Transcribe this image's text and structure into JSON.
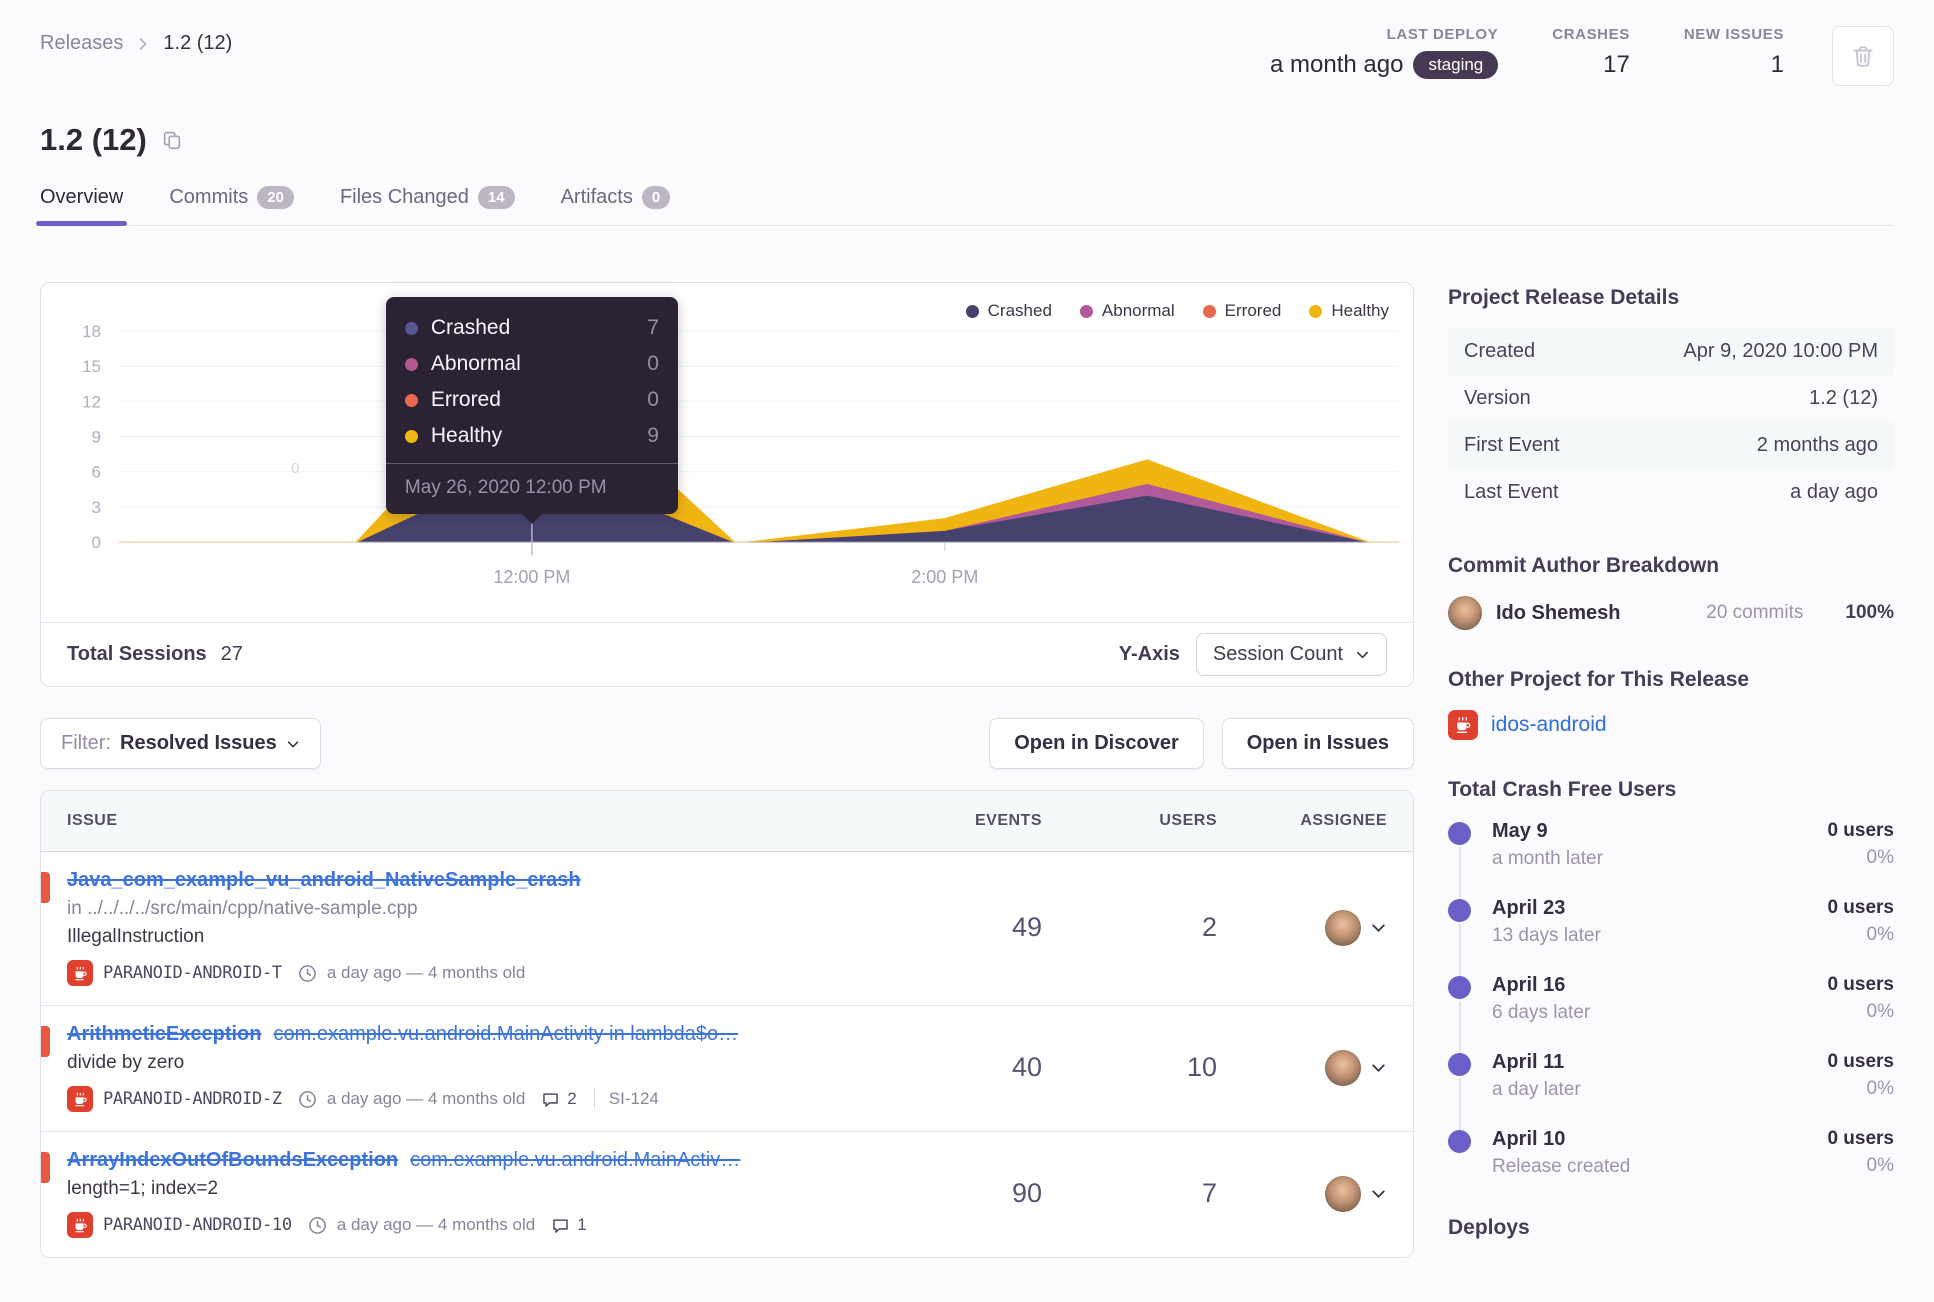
{
  "breadcrumb": {
    "parent": "Releases",
    "current": "1.2 (12)"
  },
  "header": {
    "title": "1.2 (12)",
    "stats": [
      {
        "label": "LAST DEPLOY",
        "value": "a month ago",
        "badge": "staging"
      },
      {
        "label": "CRASHES",
        "value": "17"
      },
      {
        "label": "NEW ISSUES",
        "value": "1"
      }
    ]
  },
  "tabs": [
    {
      "label": "Overview",
      "active": true
    },
    {
      "label": "Commits",
      "badge": "20"
    },
    {
      "label": "Files Changed",
      "badge": "14"
    },
    {
      "label": "Artifacts",
      "badge": "0"
    }
  ],
  "chart_data": {
    "type": "area",
    "stacked": true,
    "x_unit": "hours after 10:00 AM",
    "x": [
      0,
      1.15,
      2,
      2.98,
      3.05,
      4,
      4.98,
      6.05,
      6.2
    ],
    "x_tick_labels": [
      {
        "t": 2,
        "label": "12:00 PM"
      },
      {
        "t": 4,
        "label": "2:00 PM"
      }
    ],
    "y_ticks": [
      0,
      3,
      6,
      9,
      12,
      15,
      18
    ],
    "ylim": [
      0,
      19
    ],
    "grid": true,
    "legend_position": "top-right",
    "pointer_t": 2,
    "stray_label": "0",
    "series": [
      {
        "name": "Crashed",
        "color": "#45426e",
        "values": [
          0,
          0,
          7,
          0,
          0,
          1,
          4,
          0,
          0
        ]
      },
      {
        "name": "Abnormal",
        "color": "#b05a9a",
        "values": [
          0,
          0,
          0,
          0,
          0,
          0,
          1,
          0,
          0
        ]
      },
      {
        "name": "Errored",
        "color": "#e8684e",
        "values": [
          0,
          0,
          0,
          0,
          0,
          0,
          0,
          0,
          0
        ]
      },
      {
        "name": "Healthy",
        "color": "#f1b512",
        "values": [
          0,
          0,
          9,
          0,
          0,
          1,
          2,
          0,
          0
        ]
      }
    ]
  },
  "chart_tooltip": {
    "rows": [
      {
        "label": "Crashed",
        "value": "7",
        "color": "#53588e"
      },
      {
        "label": "Abnormal",
        "value": "0",
        "color": "#b5568f"
      },
      {
        "label": "Errored",
        "value": "0",
        "color": "#e9684f"
      },
      {
        "label": "Healthy",
        "value": "9",
        "color": "#f3b711"
      }
    ],
    "timestamp": "May 26, 2020 12:00 PM"
  },
  "chart_footer": {
    "sessions_label": "Total Sessions",
    "sessions_value": "27",
    "axis_label": "Y-Axis",
    "axis_value": "Session Count"
  },
  "toolbar": {
    "filter_label": "Filter:",
    "filter_value": "Resolved Issues",
    "open_discover": "Open in Discover",
    "open_issues": "Open in Issues"
  },
  "issues": {
    "columns": {
      "issue": "ISSUE",
      "events": "EVENTS",
      "users": "USERS",
      "assignee": "ASSIGNEE"
    },
    "rows": [
      {
        "title": "Java_com_example_vu_android_NativeSample_crash",
        "culprit": "",
        "location": "in ../../../../src/main/cpp/native-sample.cpp",
        "detail": "IllegalInstruction",
        "project": "PARANOID-ANDROID-T",
        "age": "a day ago — 4 months old",
        "comments": "",
        "ticket": "",
        "events": "49",
        "users": "2"
      },
      {
        "title": "ArithmeticException",
        "culprit": "com.example.vu.android.MainActivity in lambda$o…",
        "location": "",
        "detail": "divide by zero",
        "project": "PARANOID-ANDROID-Z",
        "age": "a day ago — 4 months old",
        "comments": "2",
        "ticket": "SI-124",
        "events": "40",
        "users": "10"
      },
      {
        "title": "ArrayIndexOutOfBoundsException",
        "culprit": "com.example.vu.android.MainActiv…",
        "location": "",
        "detail": "length=1; index=2",
        "project": "PARANOID-ANDROID-10",
        "age": "a day ago — 4 months old",
        "comments": "1",
        "ticket": "",
        "events": "90",
        "users": "7"
      }
    ]
  },
  "sidebar": {
    "release_details": {
      "heading": "Project Release Details",
      "rows": [
        {
          "label": "Created",
          "value": "Apr 9, 2020 10:00 PM"
        },
        {
          "label": "Version",
          "value": "1.2 (12)"
        },
        {
          "label": "First Event",
          "value": "2 months ago"
        },
        {
          "label": "Last Event",
          "value": "a day ago"
        }
      ]
    },
    "commit_authors": {
      "heading": "Commit Author Breakdown",
      "authors": [
        {
          "name": "Ido Shemesh",
          "commits": "20 commits",
          "percent": "100%"
        }
      ]
    },
    "other_project": {
      "heading": "Other Project for This Release",
      "project": "idos-android"
    },
    "crash_free": {
      "heading": "Total Crash Free Users",
      "items": [
        {
          "date": "May 9",
          "note": "a month later",
          "users": "0 users",
          "percent": "0%"
        },
        {
          "date": "April 23",
          "note": "13 days later",
          "users": "0 users",
          "percent": "0%"
        },
        {
          "date": "April 16",
          "note": "6 days later",
          "users": "0 users",
          "percent": "0%"
        },
        {
          "date": "April 11",
          "note": "a day later",
          "users": "0 users",
          "percent": "0%"
        },
        {
          "date": "April 10",
          "note": "Release created",
          "users": "0 users",
          "percent": "0%"
        }
      ]
    },
    "deploys_heading": "Deploys"
  }
}
